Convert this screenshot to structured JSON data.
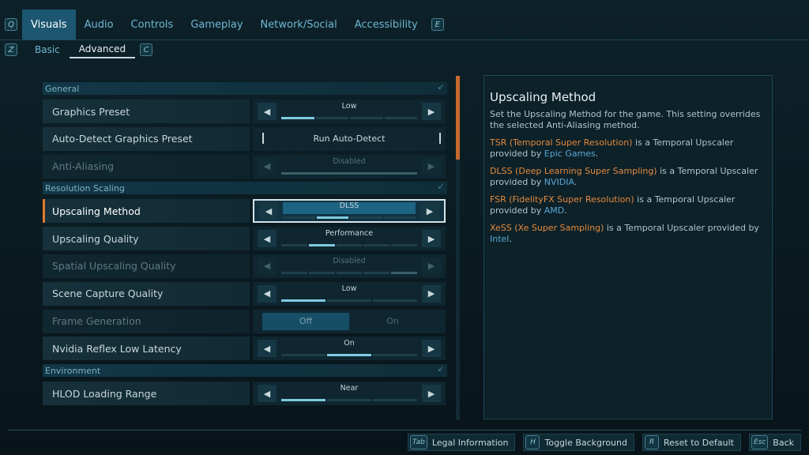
{
  "nav": {
    "prev_key": "Q",
    "next_key": "E",
    "tabs": [
      {
        "label": "Visuals",
        "active": true
      },
      {
        "label": "Audio"
      },
      {
        "label": "Controls"
      },
      {
        "label": "Gameplay"
      },
      {
        "label": "Network/Social"
      },
      {
        "label": "Accessibility"
      }
    ]
  },
  "subnav": {
    "prev_key": "Z",
    "next_key": "C",
    "tabs": [
      {
        "label": "Basic"
      },
      {
        "label": "Advanced",
        "active": true
      }
    ]
  },
  "sections": {
    "general": "General",
    "resolution": "Resolution Scaling",
    "environment": "Environment"
  },
  "settings": {
    "graphics_preset": {
      "label": "Graphics Preset",
      "value": "Low",
      "level": "1 of 4"
    },
    "auto_detect": {
      "label": "Auto-Detect Graphics Preset",
      "value": "Run Auto-Detect"
    },
    "anti_aliasing": {
      "label": "Anti-Aliasing",
      "value": "Disabled",
      "level": "1 of 1"
    },
    "upscaling_method": {
      "label": "Upscaling Method",
      "value": "DLSS",
      "level": "2 of 4"
    },
    "upscaling_quality": {
      "label": "Upscaling Quality",
      "value": "Performance",
      "level": "2 of 5"
    },
    "spatial_upscaling": {
      "label": "Spatial Upscaling Quality",
      "value": "Disabled",
      "level": "5 of 5"
    },
    "scene_capture": {
      "label": "Scene Capture Quality",
      "value": "Low",
      "level": "1 of 3"
    },
    "frame_generation": {
      "label": "Frame Generation",
      "off": "Off",
      "on": "On",
      "selected": "Off"
    },
    "nvidia_reflex": {
      "label": "Nvidia Reflex Low Latency",
      "value": "On",
      "level": "2 of 3"
    },
    "hlod_range": {
      "label": "HLOD Loading Range",
      "value": "Near",
      "level": "1 of 3"
    }
  },
  "panel": {
    "title": "Upscaling Method",
    "description": "Set the Upscaling Method for the game. This setting overrides the selected Anti-Aliasing method.",
    "entries": [
      {
        "name": "TSR (Temporal Super Resolution)",
        "text": " is a Temporal Upscaler provided by ",
        "vendor": "Epic Games",
        "end": "."
      },
      {
        "name": "DLSS (Deep Learning Super Sampling)",
        "text": " is a Temporal Upscaler provided by ",
        "vendor": "NVIDIA",
        "end": "."
      },
      {
        "name": "FSR (FidelityFX Super Resolution)",
        "text": " is a Temporal Upscaler provided by ",
        "vendor": "AMD",
        "end": "."
      },
      {
        "name": "XeSS (Xe Super Sampling)",
        "text": " is a Temporal Upscaler provided by ",
        "vendor": "Intel",
        "end": "."
      }
    ]
  },
  "footer": [
    {
      "key": "Tab",
      "label": "Legal Information"
    },
    {
      "key": "H",
      "label": "Toggle Background"
    },
    {
      "key": "R",
      "label": "Reset to Default"
    },
    {
      "key": "Esc",
      "label": "Back"
    }
  ],
  "colors": {
    "accent": "#e07a2e",
    "active_tab": "#1d5671",
    "link": "#5aa7d4",
    "highlight": "#e48a3c"
  }
}
